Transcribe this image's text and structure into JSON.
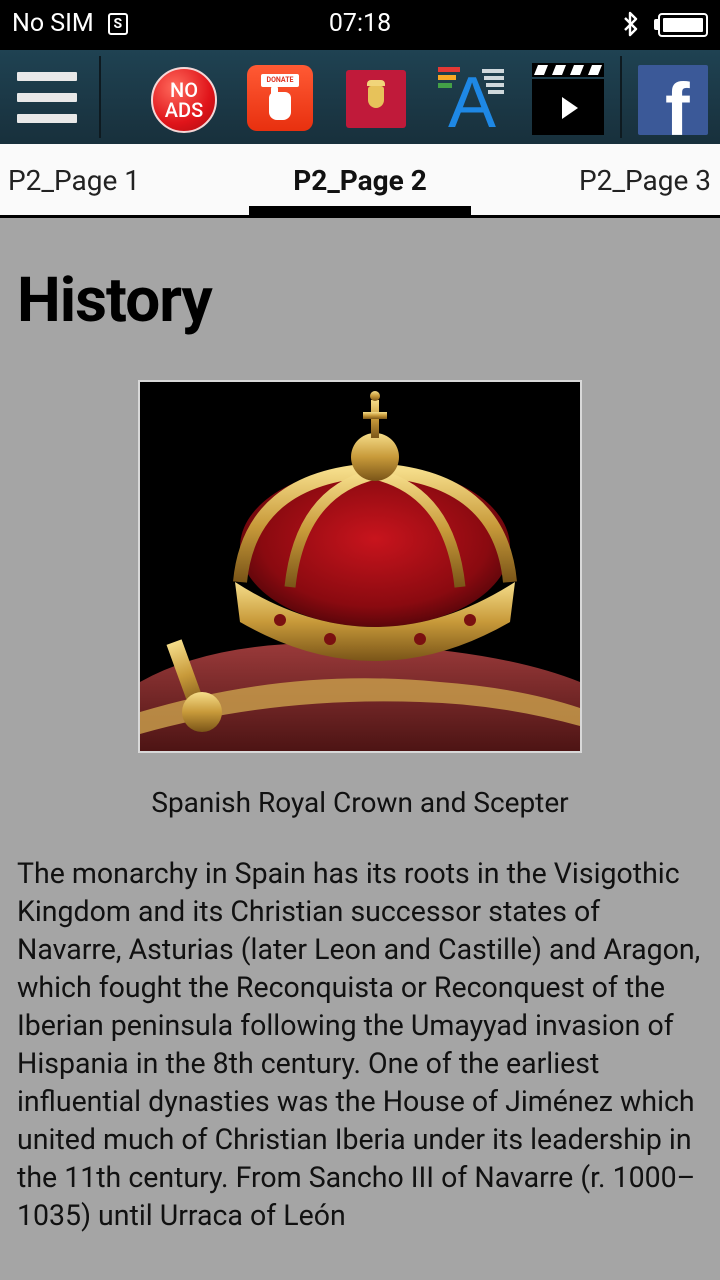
{
  "status_bar": {
    "carrier": "No SIM",
    "sim_badge": "S",
    "time": "07:18"
  },
  "toolbar": {
    "icons": [
      "menu-icon",
      "no-ads-icon",
      "donate-icon",
      "royal-arms-icon",
      "font-size-icon",
      "video-icon",
      "facebook-icon"
    ],
    "no_ads_line1": "NO",
    "no_ads_line2": "ADS",
    "donate_label": "DONATE",
    "font_icon_letter": "A",
    "facebook_letter": "f"
  },
  "tabs": [
    {
      "label": "P2_Page 1",
      "active": false
    },
    {
      "label": "P2_Page 2",
      "active": true
    },
    {
      "label": "P2_Page 3",
      "active": false
    }
  ],
  "article": {
    "title": "History",
    "image_caption": "Spanish Royal Crown and Scepter",
    "body": "The monarchy in Spain has its roots in the Visigothic Kingdom and its Christian successor states of Navarre, Asturias (later Leon and Castille) and Aragon, which fought the Reconquista or Reconquest of the Iberian peninsula following the Umayyad invasion of Hispania in the 8th century. One of the earliest influential dynasties was the House of Jiménez which united much of Christian Iberia under its leadership in the 11th century. From Sancho III of Navarre (r. 1000–1035) until Urraca of León"
  },
  "colors": {
    "status_bar_bg": "#000000",
    "toolbar_bg": "#1f4252",
    "tab_bar_bg": "#fafafa",
    "tab_indicator": "#000000",
    "content_bg": "#a5a5a5",
    "facebook_blue": "#3b5998",
    "no_ads_red": "#e0141a",
    "donate_orange": "#e8300f",
    "royal_red": "#c01a3a"
  }
}
